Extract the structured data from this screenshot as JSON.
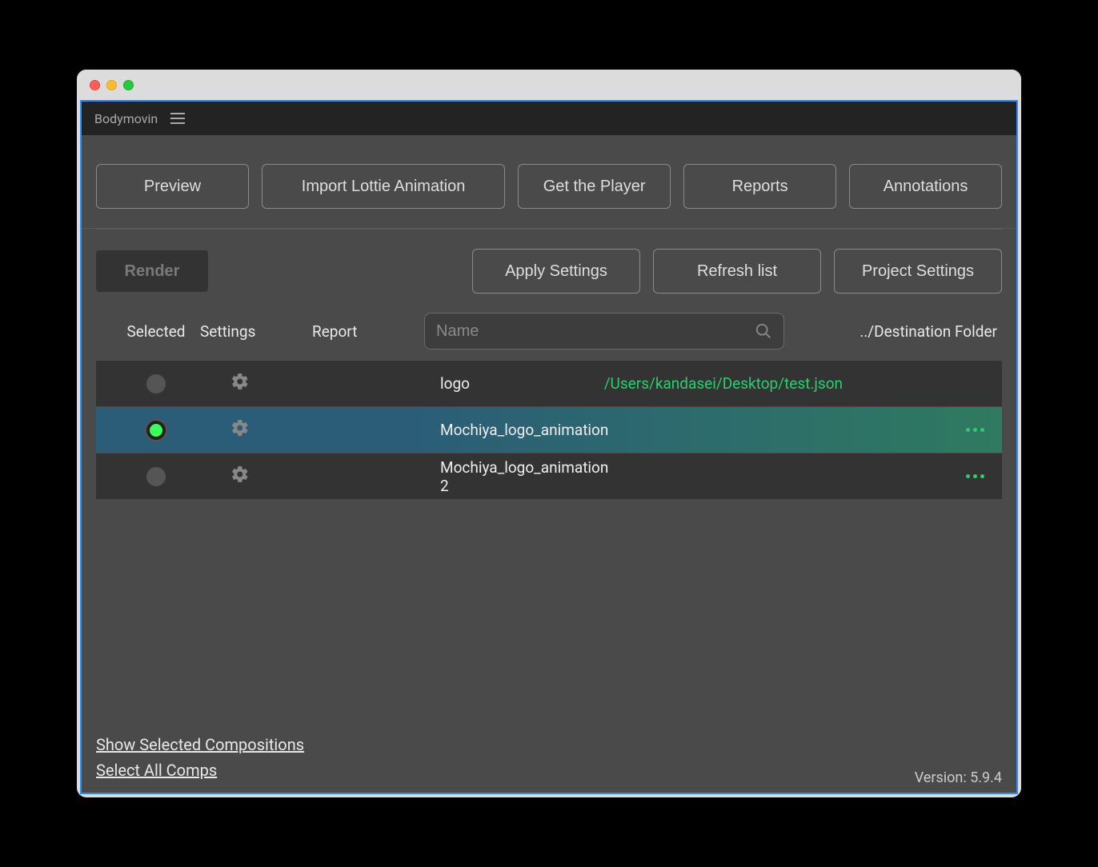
{
  "app": {
    "title": "Bodymovin"
  },
  "toolbar": {
    "preview": "Preview",
    "import": "Import Lottie Animation",
    "get_player": "Get the Player",
    "reports": "Reports",
    "annotations": "Annotations"
  },
  "actions": {
    "render": "Render",
    "apply": "Apply Settings",
    "refresh": "Refresh list",
    "project": "Project Settings"
  },
  "columns": {
    "selected": "Selected",
    "settings": "Settings",
    "report": "Report",
    "name_placeholder": "Name",
    "destination": "../Destination Folder"
  },
  "rows": [
    {
      "selected": false,
      "name": "logo",
      "destination": "/Users/kandasei/Desktop/test.json",
      "show_more": false
    },
    {
      "selected": true,
      "name": "Mochiya_logo_animation",
      "destination": "",
      "show_more": true
    },
    {
      "selected": false,
      "name": "Mochiya_logo_animation 2",
      "destination": "",
      "show_more": true
    }
  ],
  "footer": {
    "show_selected": "Show Selected Compositions",
    "select_all": "Select All Comps",
    "version": "Version: 5.9.4"
  }
}
